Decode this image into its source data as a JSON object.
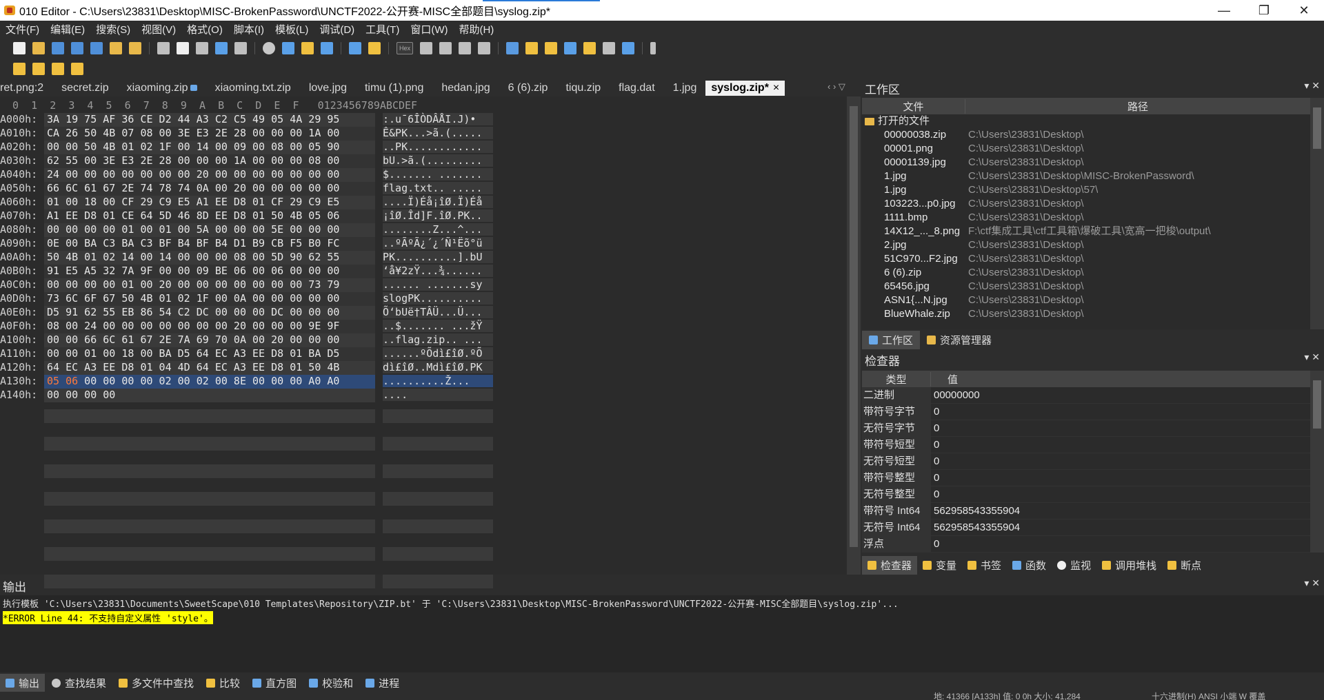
{
  "window": {
    "title": "010 Editor - C:\\Users\\23831\\Desktop\\MISC-BrokenPassword\\UNCTF2022-公开赛-MISC全部题目\\syslog.zip*",
    "minimize": "—",
    "maximize": "❐",
    "close": "✕"
  },
  "menu": [
    "文件(F)",
    "编辑(E)",
    "搜索(S)",
    "视图(V)",
    "格式(O)",
    "脚本(I)",
    "模板(L)",
    "调试(D)",
    "工具(T)",
    "窗口(W)",
    "帮助(H)"
  ],
  "tabs": [
    "ret.png:2",
    "secret.zip",
    "xiaoming.zip",
    "xiaoming.txt.zip",
    "love.jpg",
    "timu (1).png",
    "hedan.jpg",
    "6 (6).zip",
    "tiqu.zip",
    "flag.dat",
    "1.jpg"
  ],
  "active_tab": "syslog.zip*",
  "tab_nav": "‹ › ▽",
  "hex_header": "  0  1  2  3  4  5  6  7  8  9  A  B  C  D  E  F   0123456789ABCDEF",
  "hex_rows": [
    {
      "off": "A000h:",
      "hex": "3A 19 75 AF 36 CE D2 44 A3 C2 C5 49 05 4A 29 95",
      "asc": ":.u¯6ÎÒDÂÅI.J)•"
    },
    {
      "off": "A010h:",
      "hex": "CA 26 50 4B 07 08 00 3E E3 2E 28 00 00 00 1A 00",
      "asc": "Ê&PK...>ã.(....."
    },
    {
      "off": "A020h:",
      "hex": "00 00 50 4B 01 02 1F 00 14 00 09 00 08 00 05 90",
      "asc": "..PK............"
    },
    {
      "off": "A030h:",
      "hex": "62 55 00 3E E3 2E 28 00 00 00 1A 00 00 00 08 00",
      "asc": "bU.>ã.(........."
    },
    {
      "off": "A040h:",
      "hex": "24 00 00 00 00 00 00 00 20 00 00 00 00 00 00 00",
      "asc": "$....... ......."
    },
    {
      "off": "A050h:",
      "hex": "66 6C 61 67 2E 74 78 74 0A 00 20 00 00 00 00 00",
      "asc": "flag.txt.. ....."
    },
    {
      "off": "A060h:",
      "hex": "01 00 18 00 CF 29 C9 E5 A1 EE D8 01 CF 29 C9 E5",
      "asc": "....Ï)Éå¡îØ.Ï)Éå"
    },
    {
      "off": "A070h:",
      "hex": "A1 EE D8 01 CE 64 5D 46 8D EE D8 01 50 4B 05 06",
      "asc": "¡îØ.Îd]F.îØ.PK.."
    },
    {
      "off": "A080h:",
      "hex": "00 00 00 00 01 00 01 00 5A 00 00 00 5E 00 00 00",
      "asc": "........Z...^..."
    },
    {
      "off": "A090h:",
      "hex": "0E 00 BA C3 BA C3 BF B4 BF B4 D1 B9 CB F5 B0 FC",
      "asc": "..ºÃºÃ¿´¿´Ñ¹Ëõ°ü"
    },
    {
      "off": "A0A0h:",
      "hex": "50 4B 01 02 14 00 14 00 00 00 08 00 5D 90 62 55",
      "asc": "PK..........].bU"
    },
    {
      "off": "A0B0h:",
      "hex": "91 E5 A5 32 7A 9F 00 00 09 BE 06 00 06 00 00 00",
      "asc": "‘å¥2zŸ...¾......"
    },
    {
      "off": "A0C0h:",
      "hex": "00 00 00 00 01 00 20 00 00 00 00 00 00 00 73 79",
      "asc": "...... .......sy"
    },
    {
      "off": "A0D0h:",
      "hex": "73 6C 6F 67 50 4B 01 02 1F 00 0A 00 00 00 00 00",
      "asc": "slogPK.........."
    },
    {
      "off": "A0E0h:",
      "hex": "D5 91 62 55 EB 86 54 C2 DC 00 00 00 DC 00 00 00",
      "asc": "Õ‘bUë†TÂÜ...Ü..."
    },
    {
      "off": "A0F0h:",
      "hex": "08 00 24 00 00 00 00 00 00 00 20 00 00 00 9E 9F",
      "asc": "..$....... ...žŸ"
    },
    {
      "off": "A100h:",
      "hex": "00 00 66 6C 61 67 2E 7A 69 70 0A 00 20 00 00 00",
      "asc": "..flag.zip.. ..."
    },
    {
      "off": "A110h:",
      "hex": "00 00 01 00 18 00 BA D5 64 EC A3 EE D8 01 BA D5",
      "asc": "......ºÕdì£îØ.ºÕ"
    },
    {
      "off": "A120h:",
      "hex": "64 EC A3 EE D8 01 04 4D 64 EC A3 EE D8 01 50 4B",
      "asc": "dì£îØ..Mdì£îØ.PK"
    },
    {
      "off": "A130h:",
      "hex": "05 06 00 00 00 00 02 00 02 00 8E 00 00 00 A0 A0",
      "asc": "..........Ž...  ",
      "hl": "05 06"
    },
    {
      "off": "A140h:",
      "hex": "00 00 00 00",
      "asc": "...."
    }
  ],
  "workspace": {
    "title": "工作区",
    "col_file": "文件",
    "col_path": "路径",
    "group": "打开的文件",
    "files": [
      {
        "name": "00000038.zip",
        "path": "C:\\Users\\23831\\Desktop\\"
      },
      {
        "name": "00001.png",
        "path": "C:\\Users\\23831\\Desktop\\"
      },
      {
        "name": "00001139.jpg",
        "path": "C:\\Users\\23831\\Desktop\\"
      },
      {
        "name": "1.jpg",
        "path": "C:\\Users\\23831\\Desktop\\MISC-BrokenPassword\\"
      },
      {
        "name": "1.jpg",
        "path": "C:\\Users\\23831\\Desktop\\57\\"
      },
      {
        "name": "103223...p0.jpg",
        "path": "C:\\Users\\23831\\Desktop\\"
      },
      {
        "name": "1111.bmp",
        "path": "C:\\Users\\23831\\Desktop\\"
      },
      {
        "name": "14X12_..._8.png",
        "path": "F:\\ctf集成工具\\ctf工具箱\\爆破工具\\宽高一把梭\\output\\"
      },
      {
        "name": "2.jpg",
        "path": "C:\\Users\\23831\\Desktop\\"
      },
      {
        "name": "51C970...F2.jpg",
        "path": "C:\\Users\\23831\\Desktop\\"
      },
      {
        "name": "6 (6).zip",
        "path": "C:\\Users\\23831\\Desktop\\"
      },
      {
        "name": "65456.jpg",
        "path": "C:\\Users\\23831\\Desktop\\"
      },
      {
        "name": "ASN1{...N.jpg",
        "path": "C:\\Users\\23831\\Desktop\\"
      },
      {
        "name": "BlueWhale.zip",
        "path": "C:\\Users\\23831\\Desktop\\"
      }
    ],
    "tab_workspace": "工作区",
    "tab_explorer": "资源管理器"
  },
  "inspector": {
    "title": "检查器",
    "col_type": "类型",
    "col_value": "值",
    "rows": [
      {
        "k": "二进制",
        "v": "00000000"
      },
      {
        "k": "带符号字节",
        "v": "0"
      },
      {
        "k": "无符号字节",
        "v": "0"
      },
      {
        "k": "带符号短型",
        "v": "0"
      },
      {
        "k": "无符号短型",
        "v": "0"
      },
      {
        "k": "带符号整型",
        "v": "0"
      },
      {
        "k": "无符号整型",
        "v": "0"
      },
      {
        "k": "带符号 Int64",
        "v": "562958543355904"
      },
      {
        "k": "无符号 Int64",
        "v": "562958543355904"
      },
      {
        "k": "浮点",
        "v": "0"
      }
    ],
    "tabs": [
      "检查器",
      "变量",
      "书签",
      "函数",
      "监视",
      "调用堆栈",
      "断点"
    ]
  },
  "output": {
    "title": "输出",
    "line1": "执行模板 'C:\\Users\\23831\\Documents\\SweetScape\\010 Templates\\Repository\\ZIP.bt' 于 'C:\\Users\\23831\\Desktop\\MISC-BrokenPassword\\UNCTF2022-公开赛-MISC全部题目\\syslog.zip'...",
    "error": "*ERROR Line 44: 不支持自定义属性 'style'。",
    "tabs": [
      "输出",
      "查找结果",
      "多文件中查找",
      "比较",
      "直方图",
      "校验和",
      "进程"
    ]
  },
  "status": {
    "left": "地: 41366 [A133h]  值: 0 0h  大小: 41,284",
    "right": "十六进制(H)  ANSI  小端    W  覆盖"
  },
  "panel_close": "▾ ✕",
  "colors": {
    "accent": "#2a7ad8",
    "highlight": "#ff7a3a",
    "selection": "#2e4a78",
    "error_bg": "#ffff00"
  }
}
